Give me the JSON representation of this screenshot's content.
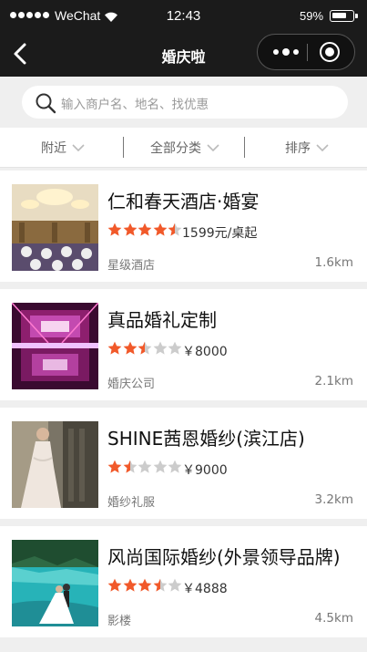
{
  "status_bar": {
    "carrier": "WeChat",
    "time": "12:43",
    "battery": "59%"
  },
  "nav": {
    "title": "婚庆啦"
  },
  "search": {
    "placeholder": "输入商户名、地名、找优惠"
  },
  "filters": [
    {
      "label": "附近"
    },
    {
      "label": "全部分类"
    },
    {
      "label": "排序"
    }
  ],
  "listings": [
    {
      "name": "仁和春天酒店·婚宴",
      "rating": 4.5,
      "price": "1599元/桌起",
      "category": "星级酒店",
      "distance": "1.6km"
    },
    {
      "name": "真品婚礼定制",
      "rating": 2.5,
      "price": "￥8000",
      "category": "婚庆公司",
      "distance": "2.1km"
    },
    {
      "name": "SHINE茜恩婚纱(滨江店)",
      "rating": 1.5,
      "price": "￥9000",
      "category": "婚纱礼服",
      "distance": "3.2km"
    },
    {
      "name": "风尚国际婚纱(外景领导品牌)",
      "rating": 3.5,
      "price": "￥4888",
      "category": "影楼",
      "distance": "4.5km"
    }
  ],
  "colors": {
    "star_active": "#f1592a",
    "star_inactive": "#cccccc",
    "header_bg": "#1b1b1b"
  }
}
